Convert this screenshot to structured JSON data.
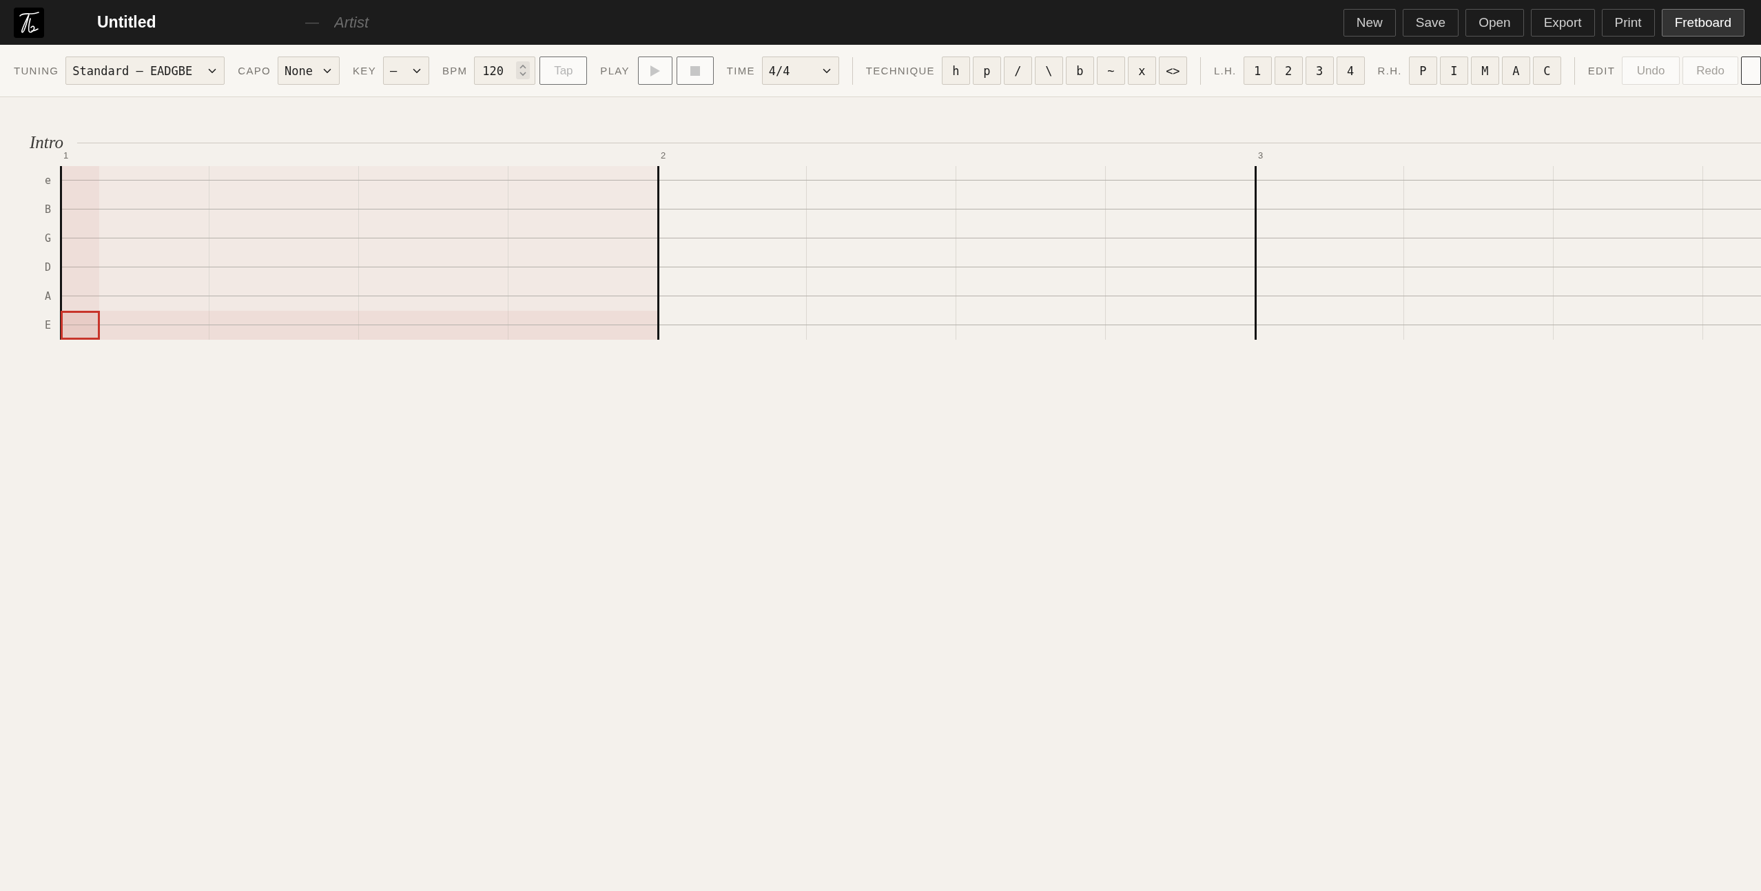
{
  "header": {
    "title": "Untitled",
    "separator": "—",
    "artist": {
      "placeholder": "Artist"
    },
    "buttons": [
      {
        "label": "New",
        "selected": false
      },
      {
        "label": "Save",
        "selected": false
      },
      {
        "label": "Open",
        "selected": false
      },
      {
        "label": "Export",
        "selected": false
      },
      {
        "label": "Print",
        "selected": false
      },
      {
        "label": "Fretboard",
        "selected": true
      }
    ]
  },
  "toolbar": {
    "tuning": {
      "label": "TUNING",
      "value": "Standard — EADGBE"
    },
    "capo": {
      "label": "CAPO",
      "value": "None"
    },
    "key": {
      "label": "KEY",
      "value": "—"
    },
    "bpm": {
      "label": "BPM",
      "value": "120",
      "tap": "Tap"
    },
    "play": {
      "label": "PLAY",
      "buttons": [
        {
          "kind": "play"
        },
        {
          "kind": "stop"
        }
      ]
    },
    "time": {
      "label": "TIME",
      "value": "4/4"
    },
    "technique": {
      "label": "TECHNIQUE",
      "buttons": [
        "h",
        "p",
        "/",
        "\\",
        "b",
        "~",
        "x",
        "<>"
      ]
    },
    "left_hand": {
      "label": "L.H.",
      "buttons": [
        "1",
        "2",
        "3",
        "4"
      ]
    },
    "right_hand": {
      "label": "R.H.",
      "buttons": [
        "P",
        "I",
        "M",
        "A",
        "C"
      ]
    },
    "edit": {
      "label": "EDIT",
      "buttons": [
        {
          "label": "Undo",
          "disabled": true
        },
        {
          "label": "Redo",
          "disabled": true
        },
        {
          "disabled": false
        }
      ]
    }
  },
  "tab": {
    "strings": [
      {
        "name": "e",
        "selected": false
      },
      {
        "name": "B",
        "selected": false
      },
      {
        "name": "G",
        "selected": false
      },
      {
        "name": "D",
        "selected": false
      },
      {
        "name": "A",
        "selected": false
      },
      {
        "name": "E",
        "selected": true
      }
    ],
    "sections": [
      {
        "title": "Intro",
        "measures": [
          {
            "number": "1",
            "selected": true
          },
          {
            "number": "2",
            "selected": false
          },
          {
            "number": "3",
            "selected": false
          }
        ]
      }
    ]
  }
}
